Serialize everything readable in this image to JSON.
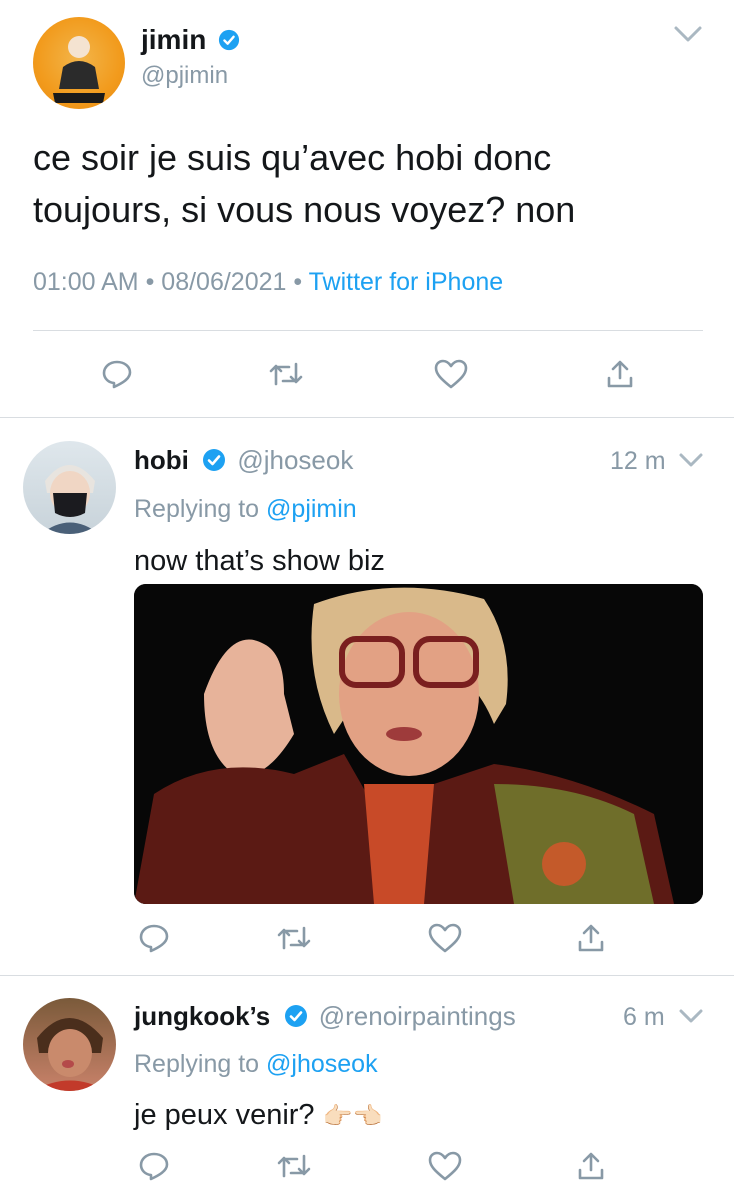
{
  "main_tweet": {
    "display_name": "jimin",
    "handle": "@pjimin",
    "text_line1": "ce soir je suis qu’avec hobi donc",
    "text_line2": "toujours, si vous nous voyez? non",
    "time": "01:00 AM",
    "date": "08/06/2021",
    "source": "Twitter for iPhone"
  },
  "replies": [
    {
      "display_name": "hobi",
      "handle": "@jhoseok",
      "age": "12 m",
      "replying_prefix": "Replying to",
      "replying_to": "@pjimin",
      "text": "now that’s show biz"
    },
    {
      "display_name": "jungkook’s",
      "handle": "@renoirpaintings",
      "age": "6 m",
      "replying_prefix": "Replying to",
      "replying_to": "@jhoseok",
      "text": "je peux venir?",
      "emoji": "👉🏻👈🏻"
    }
  ],
  "colors": {
    "accent": "#1da1f2",
    "gray": "#8899a6",
    "text": "#14171a"
  },
  "icons": [
    "chevron-down-icon",
    "verified-badge-icon",
    "reply-icon",
    "retweet-icon",
    "like-icon",
    "share-icon"
  ]
}
